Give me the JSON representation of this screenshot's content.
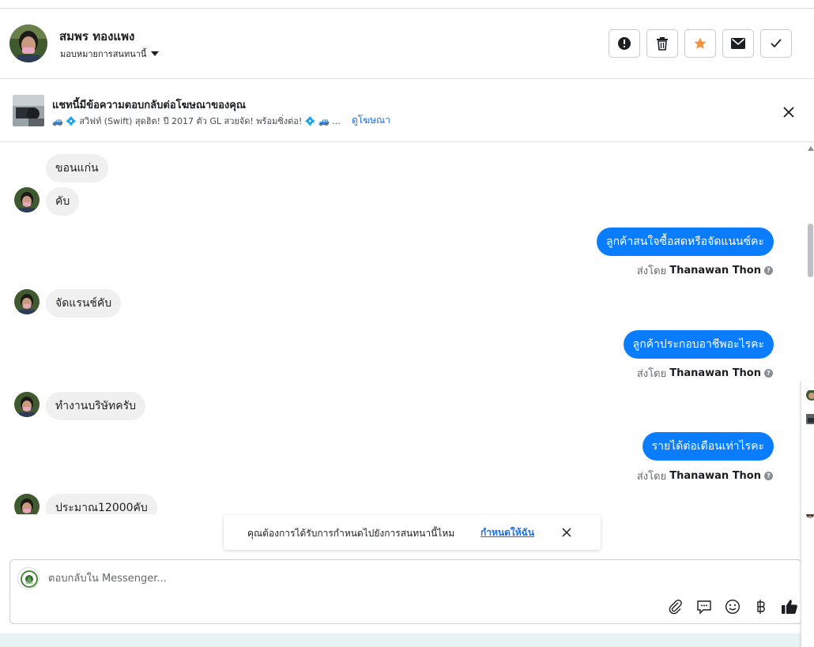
{
  "header": {
    "contact_name": "สมพร ทองแพง",
    "assign_label": "มอบหมายการสนทนานี้",
    "colors": {
      "star": "#f7923b",
      "border": "#c8cbd0"
    },
    "actions": [
      {
        "icon": "exclamation-circle-icon"
      },
      {
        "icon": "trash-icon"
      },
      {
        "icon": "star-icon"
      },
      {
        "icon": "envelope-icon"
      },
      {
        "icon": "checkmark-icon"
      }
    ]
  },
  "ad_banner": {
    "title": "แชทนี้มีข้อความตอบกลับต่อโฆษณาของคุณ",
    "description": "🚙 💠 สวิฟท์ (Swift) สุดฮิต! ปี 2017 ตัว GL สวยจัด! พร้อมซิ่งต่อ! 💠 🚙 ...",
    "link": "ดูโฆษณา"
  },
  "messages": [
    {
      "side": "in",
      "text": "ขอนแก่น"
    },
    {
      "side": "in",
      "text": "คับ"
    },
    {
      "side": "out",
      "text": "ลูกค้าสนใจซื้อสดหรือจัดแนนซ์คะ",
      "sent_by_label": "ส่งโดย",
      "sender": "Thanawan Thon"
    },
    {
      "side": "in",
      "text": "จัดแรนช์คับ"
    },
    {
      "side": "out",
      "text": "ลูกค้าประกอบอาชีพอะไรคะ",
      "sent_by_label": "ส่งโดย",
      "sender": "Thanawan Thon"
    },
    {
      "side": "in",
      "text": "ทำงานบริษัทครับ"
    },
    {
      "side": "out",
      "text": "รายได้ต่อเดือนเท่าไรคะ",
      "sent_by_label": "ส่งโดย",
      "sender": "Thanawan Thon"
    },
    {
      "side": "in",
      "text": "ประมาณ12000คับ"
    }
  ],
  "toast": {
    "text": "คุณต้องการได้รับการกำหนดไปยังการสนทนานี้ไหม",
    "link": "กำหนดให้ฉัน"
  },
  "composer": {
    "placeholder": "ตอบกลับใน Messenger...",
    "tools": [
      "paperclip-icon",
      "saved-reply-icon",
      "emoji-icon",
      "baht-icon",
      "thumbs-up-icon"
    ],
    "accent": "#1c1e21"
  },
  "colors": {
    "outgoing_bubble": "#0a7cff",
    "incoming_bubble": "#f0f0f0",
    "link": "#216fdb"
  }
}
